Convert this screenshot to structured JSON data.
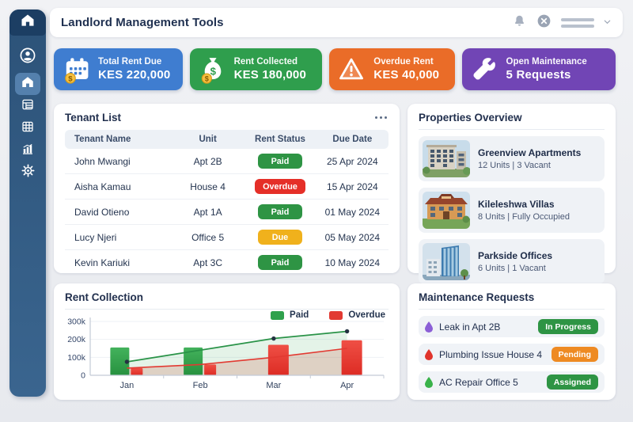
{
  "app": {
    "title": "Landlord Management Tools"
  },
  "header": {
    "icons": [
      "bell-icon",
      "close-circle-icon",
      "user-menu-placeholder",
      "chevron-down-icon"
    ]
  },
  "sidebar": {
    "logo_icon": "home-icon",
    "items": [
      {
        "name": "profile",
        "icon": "user-circle-icon",
        "active": false
      },
      {
        "name": "home",
        "icon": "home-icon",
        "active": true
      },
      {
        "name": "tenants",
        "icon": "list-icon",
        "active": false
      },
      {
        "name": "properties",
        "icon": "grid-icon",
        "active": false
      },
      {
        "name": "reports",
        "icon": "bar-chart-icon",
        "active": false
      },
      {
        "name": "settings",
        "icon": "gear-icon",
        "active": false
      }
    ]
  },
  "stat_cards": [
    {
      "label": "Total Rent Due",
      "value": "KES 220,000",
      "color": "#3f7dd0",
      "icon": "calendar-coin-icon"
    },
    {
      "label": "Rent Collected",
      "value": "KES 180,000",
      "color": "#2f9e4d",
      "icon": "money-bag-icon"
    },
    {
      "label": "Overdue Rent",
      "value": "KES 40,000",
      "color": "#ea6c28",
      "icon": "warning-triangle-icon"
    },
    {
      "label": "Open Maintenance",
      "value": "5 Requests",
      "color": "#7145b5",
      "icon": "wrench-icon"
    }
  ],
  "tenant_list": {
    "title": "Tenant List",
    "columns": [
      "Tenant Name",
      "Unit",
      "Rent Status",
      "Due Date"
    ],
    "rows": [
      {
        "name": "John Mwangi",
        "unit": "Apt 2B",
        "status": "Paid",
        "status_color": "#2e9444",
        "due_date": "25 Apr 2024"
      },
      {
        "name": "Aisha Kamau",
        "unit": "House 4",
        "status": "Overdue",
        "status_color": "#e52f28",
        "due_date": "15 Apr 2024"
      },
      {
        "name": "David Otieno",
        "unit": "Apt 1A",
        "status": "Paid",
        "status_color": "#2e9444",
        "due_date": "01 May 2024"
      },
      {
        "name": "Lucy Njeri",
        "unit": "Office 5",
        "status": "Due",
        "status_color": "#f0b11c",
        "due_date": "05 May 2024"
      },
      {
        "name": "Kevin Kariuki",
        "unit": "Apt 3C",
        "status": "Paid",
        "status_color": "#2e9444",
        "due_date": "10 May 2024"
      }
    ]
  },
  "properties": {
    "title": "Properties Overview",
    "items": [
      {
        "name": "Greenview Apartments",
        "details": "12 Units | 3 Vacant",
        "photo": "apartment-building-photo"
      },
      {
        "name": "Kileleshwa Villas",
        "details": "8 Units | Fully Occupied",
        "photo": "villa-building-photo"
      },
      {
        "name": "Parkside Offices",
        "details": "6 Units | 1 Vacant",
        "photo": "office-building-photo"
      }
    ]
  },
  "rent_collection": {
    "title": "Rent Collection"
  },
  "chart_data": {
    "type": "bar+line combo",
    "title": "Rent Collection",
    "categories": [
      "Jan",
      "Feb",
      "Mar",
      "Apr"
    ],
    "ylim": [
      0,
      300000
    ],
    "yticks": [
      {
        "value": 0,
        "label": "0"
      },
      {
        "value": 100000,
        "label": "100k"
      },
      {
        "value": 200000,
        "label": "200k"
      },
      {
        "value": 300000,
        "label": "300k"
      }
    ],
    "legend": [
      {
        "label": "Paid",
        "color": "#2fa14c"
      },
      {
        "label": "Overdue",
        "color": "#e23a32"
      }
    ],
    "legend_position": "top-right",
    "grid": true,
    "series": [
      {
        "name": "Paid",
        "type": "bar",
        "color": "#2fa14c",
        "values": [
          155000,
          155000,
          null,
          null
        ]
      },
      {
        "name": "Overdue",
        "type": "bar",
        "color": "#e23a32",
        "values": [
          40000,
          60000,
          170000,
          195000
        ]
      },
      {
        "name": "Paid trend",
        "type": "line+area",
        "color": "#2a9348",
        "fill": "rgba(47,161,76,0.13)",
        "marker_indices": [
          0,
          2,
          3
        ],
        "values": [
          75000,
          140000,
          205000,
          245000
        ]
      },
      {
        "name": "Overdue trend",
        "type": "line+area",
        "color": "#e23a32",
        "fill": "rgba(226,58,50,0.20)",
        "marker_indices": [],
        "values": [
          40000,
          60000,
          100000,
          150000
        ]
      }
    ]
  },
  "maintenance": {
    "title": "Maintenance Requests",
    "items": [
      {
        "label": "Leak in Apt 2B",
        "status": "In Progress",
        "status_color": "#2e9444",
        "dot_color": "#8b5fd6",
        "icon": "droplet-icon"
      },
      {
        "label": "Plumbing Issue House 4",
        "status": "Pending",
        "status_color": "#ee8a22",
        "dot_color": "#e0342c",
        "icon": "droplet-icon"
      },
      {
        "label": "AC Repair Office 5",
        "status": "Assigned",
        "status_color": "#2e9444",
        "dot_color": "#39b24a",
        "icon": "droplet-icon"
      }
    ]
  }
}
